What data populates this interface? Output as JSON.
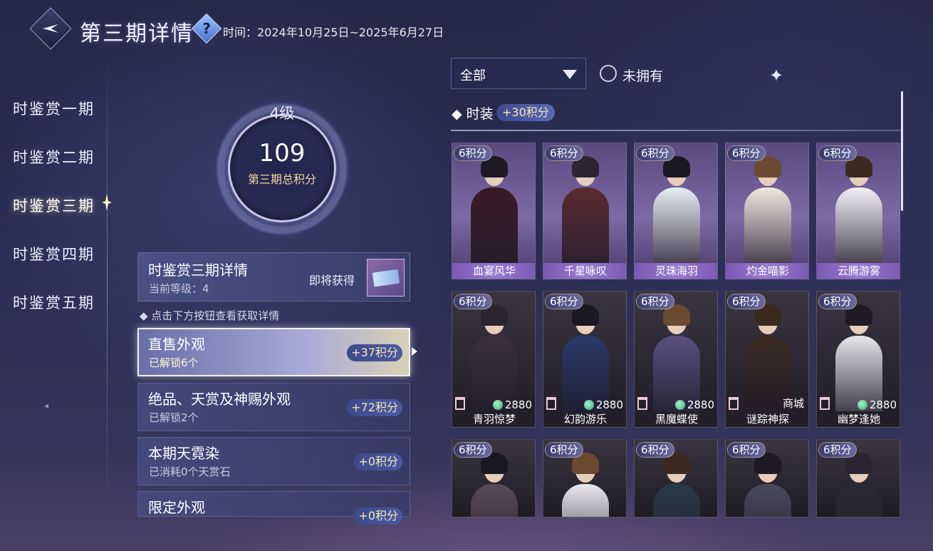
{
  "header": {
    "title": "第三期详情",
    "time_label": "时间：2024年10月25日~2025年6月27日"
  },
  "nav": {
    "items": [
      "时鉴赏一期",
      "时鉴赏二期",
      "时鉴赏三期",
      "时鉴赏四期",
      "时鉴赏五期"
    ],
    "active_index": 2
  },
  "score": {
    "level": "4级",
    "total": "109",
    "label": "第三期总积分"
  },
  "detail_card": {
    "title": "时鉴赏三期详情",
    "current_level": "当前等级：4",
    "soon_label": "即将获得"
  },
  "hint": "◆ 点击下方按钮查看获取详情",
  "categories": [
    {
      "title": "直售外观",
      "sub": "已解锁6个",
      "points": "+37积分",
      "active": true
    },
    {
      "title": "绝品、天赏及神赐外观",
      "sub": "已解锁2个",
      "points": "+72积分",
      "active": false
    },
    {
      "title": "本期天霓染",
      "sub": "已消耗0个天赏石",
      "points": "+0积分",
      "active": false
    },
    {
      "title": "限定外观",
      "sub": "",
      "points": "+0积分",
      "active": false
    }
  ],
  "filter": {
    "selected": "全部",
    "toggle_label": "未拥有"
  },
  "section": {
    "title": "◆ 时装",
    "points": "+30积分"
  },
  "cards_row1": [
    {
      "points": "6积分",
      "name": "血宴风华"
    },
    {
      "points": "6积分",
      "name": "千星咏叹"
    },
    {
      "points": "6积分",
      "name": "灵珠海羽"
    },
    {
      "points": "6积分",
      "name": "灼金喵影"
    },
    {
      "points": "6积分",
      "name": "云腾游雾"
    }
  ],
  "cards_row2": [
    {
      "points": "6积分",
      "name": "青羽惊梦",
      "price": "2880"
    },
    {
      "points": "6积分",
      "name": "幻韵游乐",
      "price": "2880"
    },
    {
      "points": "6积分",
      "name": "黑魔蝶使",
      "price": "2880"
    },
    {
      "points": "6积分",
      "name": "谜踪神探",
      "shop": "商城"
    },
    {
      "points": "6积分",
      "name": "幽梦逢她",
      "price": "2880"
    }
  ],
  "cards_row3": [
    {
      "points": "6积分"
    },
    {
      "points": "6积分"
    },
    {
      "points": "6积分"
    },
    {
      "points": "6积分"
    },
    {
      "points": "6积分"
    }
  ],
  "colors": {
    "accent_gold": "#f5e6b8",
    "panel": "#484c80",
    "background": "#2b2d52"
  },
  "icons": [
    "back-arrow-icon",
    "help-icon",
    "dropdown-triangle-icon",
    "radio-icon",
    "gem-coin-icon",
    "tag-icon",
    "sparkle-icon"
  ]
}
